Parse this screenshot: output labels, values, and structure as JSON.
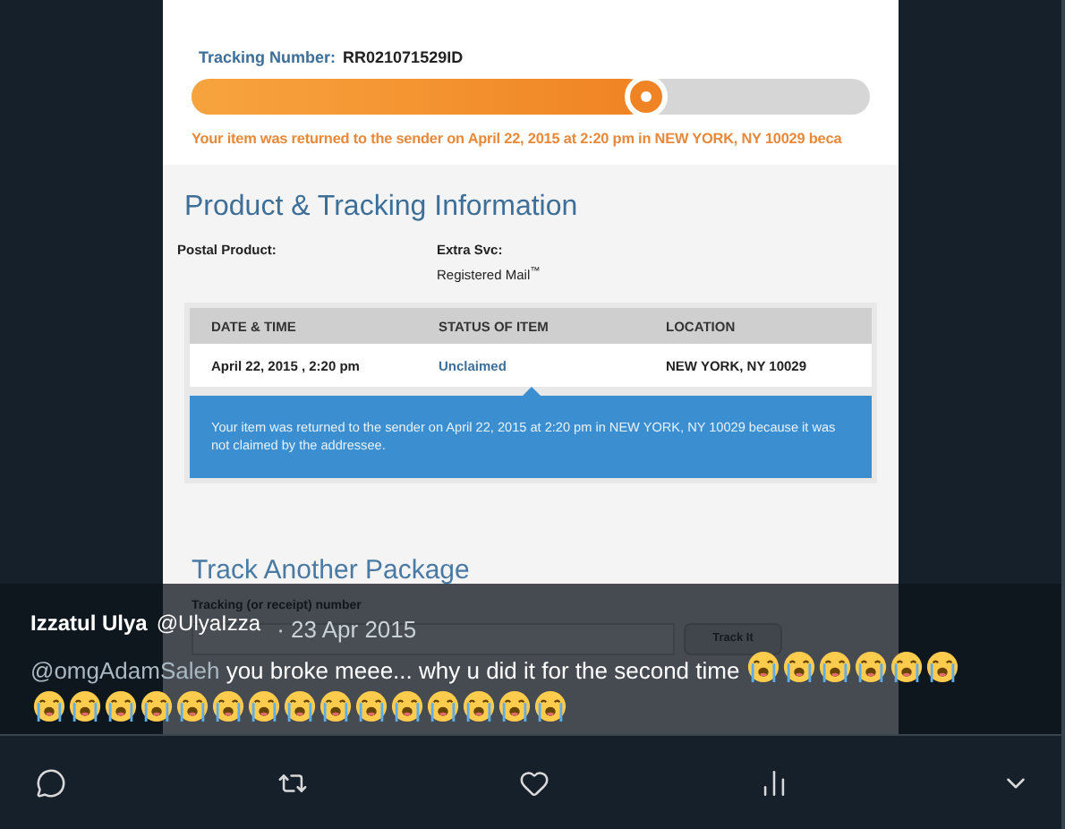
{
  "photo": {
    "tracking_label": "Tracking Number:",
    "tracking_number": "RR021071529ID",
    "progress": {
      "level": 0.67
    },
    "status_line": "Your item was returned to the sender on April 22, 2015 at 2:20 pm in NEW YORK, NY 10029 beca",
    "section_title": "Product & Tracking Information",
    "postal_product_label": "Postal Product:",
    "extra_svc_label": "Extra Svc:",
    "extra_svc_value": "Registered Mail$^{™}$",
    "table": {
      "columns": [
        "DATE & TIME",
        "STATUS OF ITEM",
        "LOCATION"
      ],
      "rows": [
        {
          "cells": [
            "April 22, 2015 , 2:20 pm",
            "Unclaimed",
            "NEW YORK, NY 10029"
          ]
        }
      ],
      "detail": "Your item was returned to the sender on April 22, 2015 at 2:20 pm in NEW YORK, NY 10029 because it was not claimed by the addressee."
    },
    "track_title": "Track Another Package",
    "track_field_label": "Tracking (or receipt) number",
    "track_button": "Track It"
  },
  "tweet": {
    "name": "Izzatul Ulya",
    "handle": "@UlyaIzza",
    "date": "· 23 Apr 2015",
    "mention": "@omgAdamSaleh",
    "text": "you broke meee... why u did it for the second time",
    "emojis": [
      {
        "kind": "loudly-crying"
      },
      {
        "kind": "loudly-crying"
      },
      {
        "kind": "loudly-crying"
      },
      {
        "kind": "loudly-crying"
      },
      {
        "kind": "loudly-crying"
      },
      {
        "kind": "loudly-crying"
      },
      {
        "kind": "loudly-crying"
      },
      {
        "kind": "loudly-crying"
      },
      {
        "kind": "loudly-crying"
      },
      {
        "kind": "loudly-crying"
      },
      {
        "kind": "loudly-crying"
      },
      {
        "kind": "loudly-crying"
      },
      {
        "kind": "loudly-crying"
      },
      {
        "kind": "loudly-crying"
      },
      {
        "kind": "loudly-crying"
      },
      {
        "kind": "loudly-crying"
      },
      {
        "kind": "loudly-crying"
      },
      {
        "kind": "loudly-crying"
      },
      {
        "kind": "loudly-crying"
      },
      {
        "kind": "loudly-crying"
      },
      {
        "kind": "loudly-crying"
      }
    ]
  },
  "actions": [
    {
      "kind": "reply"
    },
    {
      "kind": "retweet"
    },
    {
      "kind": "like"
    },
    {
      "kind": "stats"
    },
    {
      "kind": "more"
    }
  ]
}
